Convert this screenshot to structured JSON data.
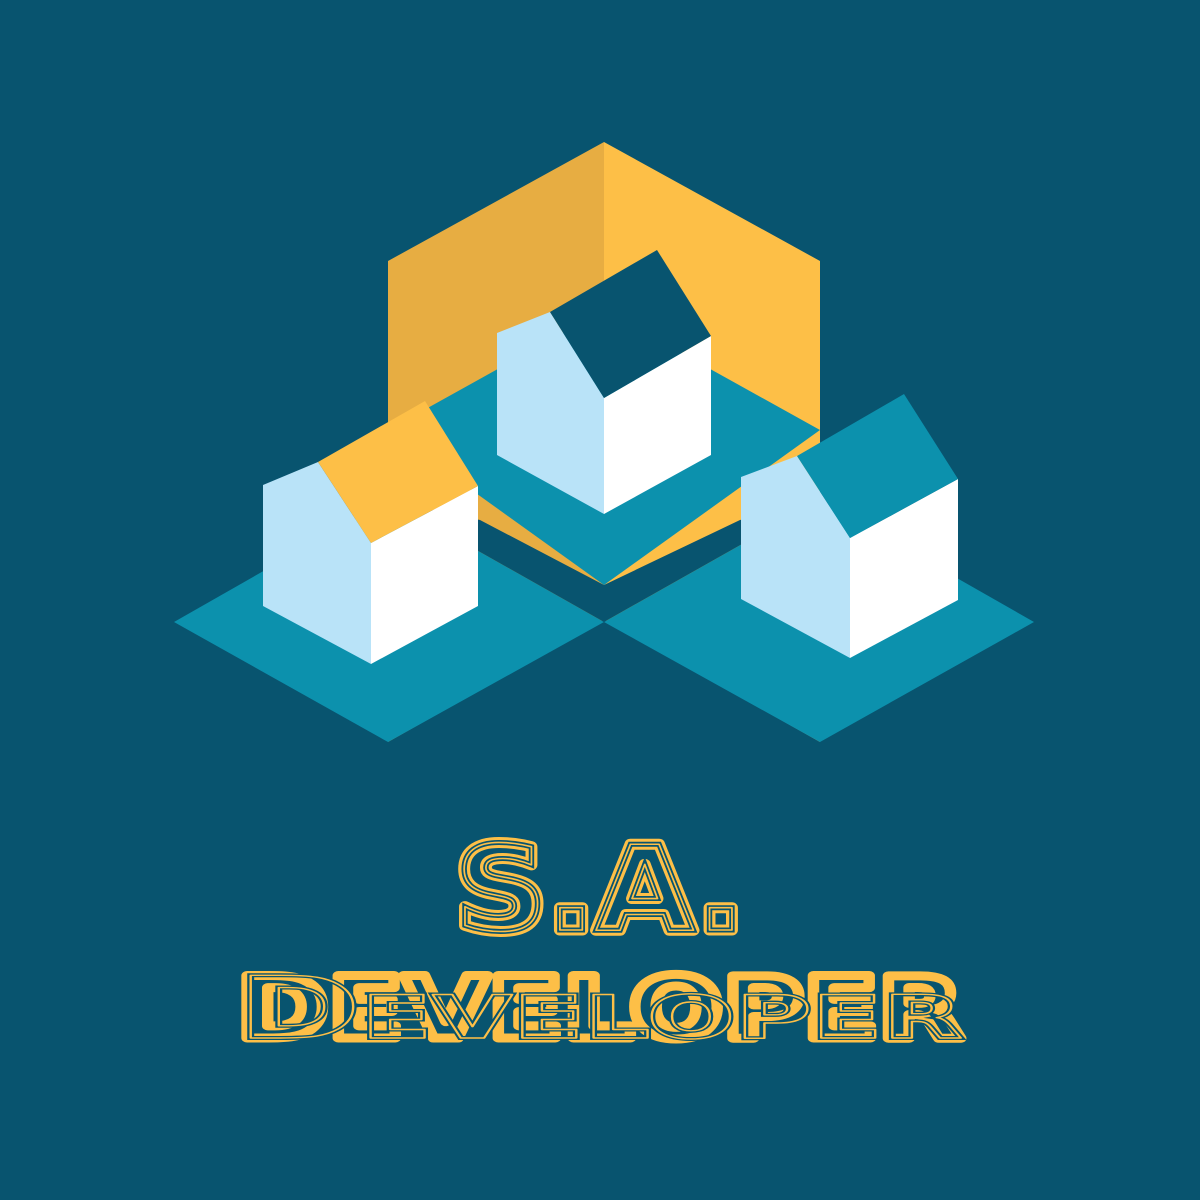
{
  "logo": {
    "title_line_1": "S.A.",
    "title_line_2": "Developer"
  },
  "colors": {
    "background": "#08546f",
    "accent_gold": "#fdbf47",
    "accent_gold_shade": "#e7ad42",
    "platform_teal": "#0c91ad",
    "wall_light": "#b9e3f8",
    "wall_white": "#ffffff"
  },
  "icons": [
    "house-icon",
    "house-icon",
    "house-icon",
    "hexagon-frame-icon"
  ]
}
